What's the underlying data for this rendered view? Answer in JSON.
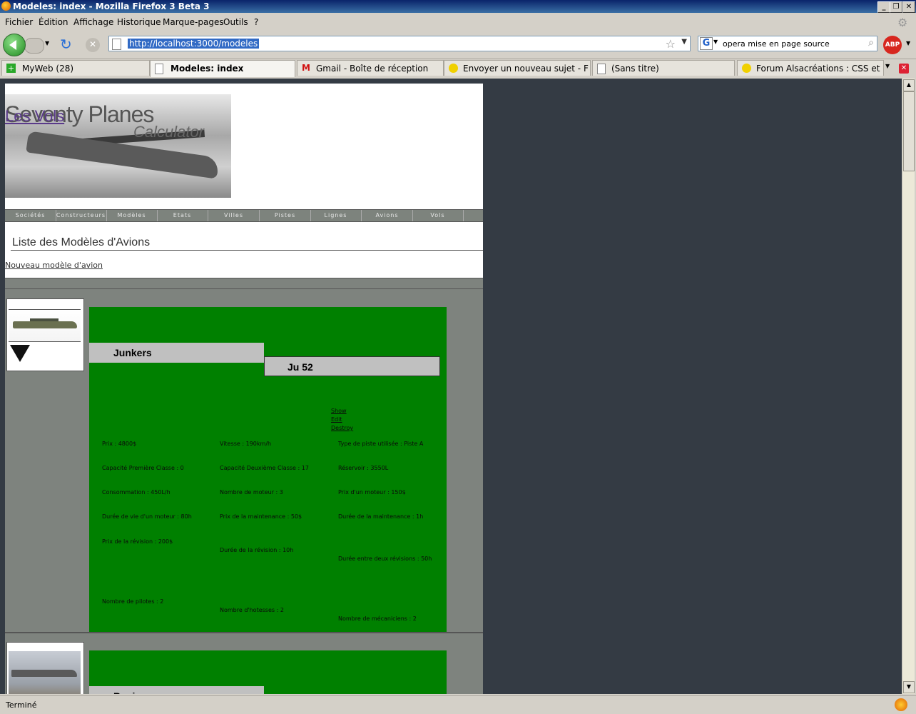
{
  "window": {
    "title": "Modeles: index - Mozilla Firefox 3 Beta 3"
  },
  "menu": [
    "Fichier",
    "Édition",
    "Affichage",
    "Historique",
    "Marque-pages",
    "Outils",
    "?"
  ],
  "url": "http://localhost:3000/modeles",
  "search": {
    "value": "opera mise en page source"
  },
  "tabs": [
    {
      "label": "MyWeb (28)",
      "active": false
    },
    {
      "label": "Modeles: index",
      "active": true
    },
    {
      "label": "Gmail - Boîte de réception",
      "active": false
    },
    {
      "label": "Envoyer un nouveau sujet - Foru...",
      "active": false
    },
    {
      "label": "(Sans titre)",
      "active": false
    },
    {
      "label": "Forum Alsacréations : CSS et Stan...",
      "active": false
    }
  ],
  "status": "Terminé",
  "page": {
    "site_title": "Seventy Planes",
    "site_subtitle": "Calculator",
    "main_link": "Les Vols",
    "nav": [
      "Sociétés",
      "Constructeurs",
      "Modèles",
      "Etats",
      "Villes",
      "Pistes",
      "Lignes",
      "Avions",
      "Vols"
    ],
    "heading": "Liste des Modèles d'Avions",
    "new_link": "Nouveau modèle d'avion",
    "models": [
      {
        "maker": "Junkers",
        "model": "Ju 52",
        "actions": [
          "Show",
          "Edit",
          "Destroy"
        ],
        "specs": [
          "Prix : 4800$",
          "Vitesse : 190km/h",
          "Type de piste utilisée : Piste A",
          "Capacité Première Classe : 0",
          "Capacité Deuxième Classe : 17",
          "Réservoir : 3550L",
          "Consommation : 450L/h",
          "Nombre de moteur : 3",
          "Prix d'un moteur : 150$",
          "Durée de vie d'un moteur : 80h",
          "Prix de la maintenance : 50$",
          "Durée de la maintenance : 1h",
          "Prix de la révision : 200$",
          "Durée de la révision : 10h",
          "Durée entre deux révisions : 50h",
          "Nombre de pilotes : 2",
          "Nombre d'hotesses : 2",
          "Nombre de mécaniciens : 2"
        ]
      },
      {
        "maker": "Boeing"
      }
    ]
  }
}
